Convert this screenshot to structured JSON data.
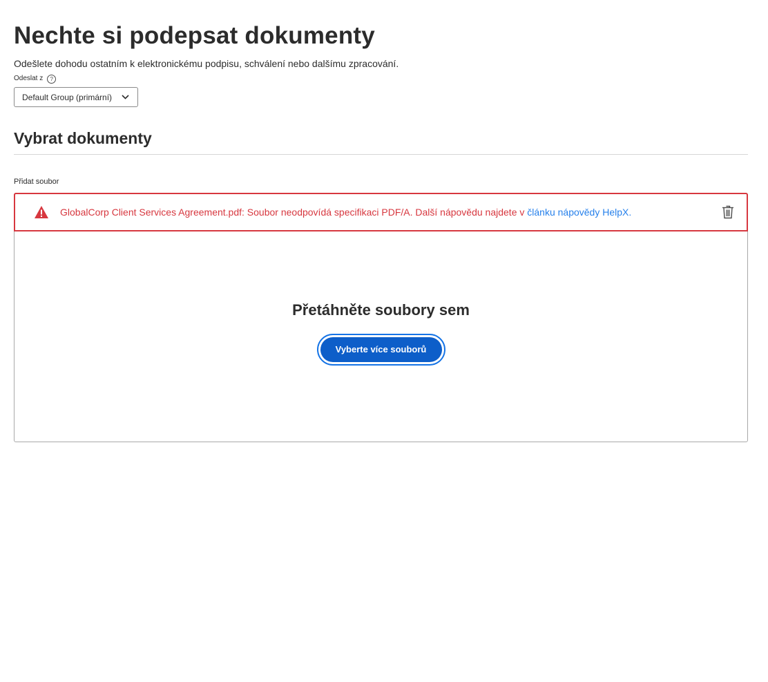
{
  "header": {
    "title": "Nechte si podepsat dokumenty",
    "subtitle": "Odešlete dohodu ostatním k elektronickému podpisu, schválení nebo dalšímu zpracování."
  },
  "send_from": {
    "label": "Odeslat z",
    "help_icon": "question-circle-icon",
    "selected_value": "Default Group (primární)"
  },
  "documents": {
    "section_title": "Vybrat dokumenty",
    "add_file_label": "Přidat soubor",
    "error": {
      "icon": "alert-triangle-icon",
      "message": "GlobalCorp Client Services Agreement.pdf: Soubor neodpovídá specifikaci PDF/A. Další nápovědu najdete v ",
      "link_text": "článku nápovědy HelpX.",
      "delete_icon": "trash-icon"
    },
    "drop_zone": {
      "title": "Přetáhněte soubory sem",
      "button_label": "Vyberte více souborů"
    }
  },
  "colors": {
    "error": "#d7373f",
    "link": "#2680eb",
    "primary_button": "#0d5ec9",
    "focus_ring": "#1473e6"
  }
}
